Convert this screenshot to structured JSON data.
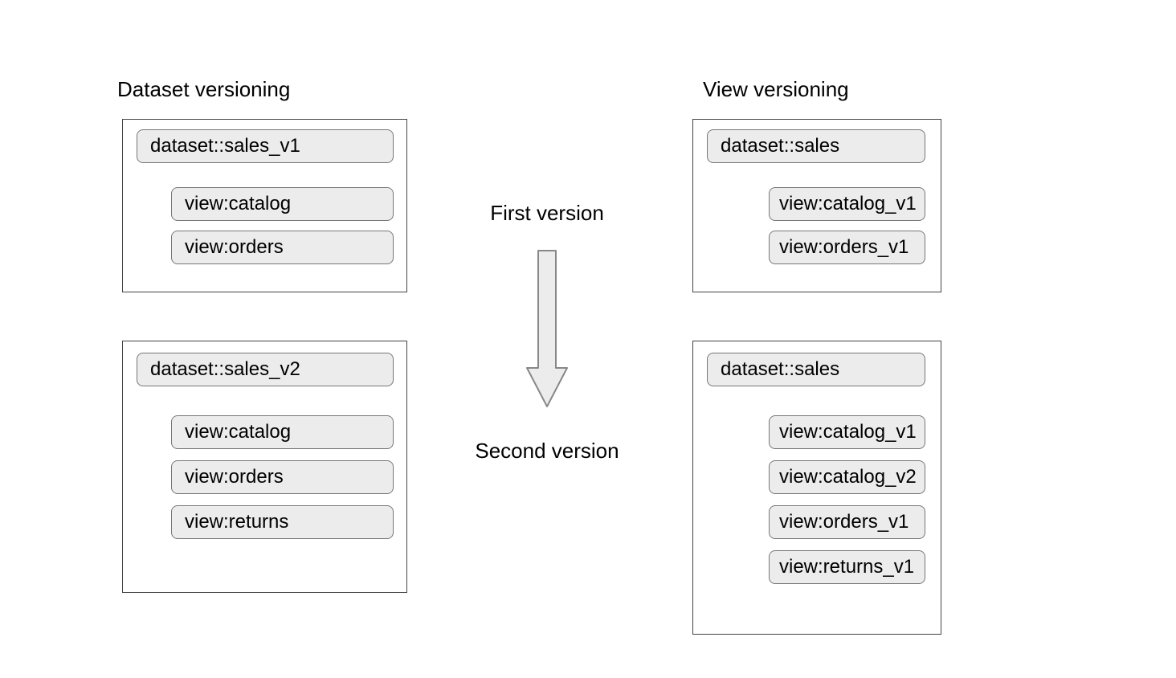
{
  "headings": {
    "left": "Dataset versioning",
    "right": "View versioning"
  },
  "center": {
    "first": "First version",
    "second": "Second version"
  },
  "left": {
    "panel1": {
      "dataset": "dataset::sales_v1",
      "views": [
        "view:catalog",
        "view:orders"
      ]
    },
    "panel2": {
      "dataset": "dataset::sales_v2",
      "views": [
        "view:catalog",
        "view:orders",
        "view:returns"
      ]
    }
  },
  "right": {
    "panel1": {
      "dataset": "dataset::sales",
      "views": [
        "view:catalog_v1",
        "view:orders_v1"
      ]
    },
    "panel2": {
      "dataset": "dataset::sales",
      "views": [
        "view:catalog_v1",
        "view:catalog_v2",
        "view:orders_v1",
        "view:returns_v1"
      ]
    }
  }
}
